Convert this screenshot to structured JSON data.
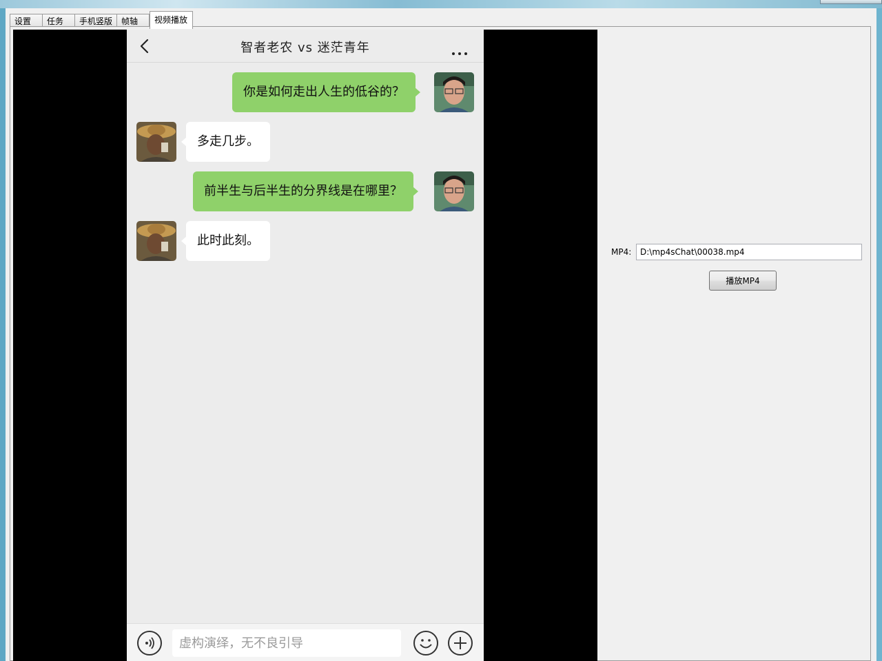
{
  "tabs": [
    {
      "label": "设置"
    },
    {
      "label": "任务"
    },
    {
      "label": "手机竖版"
    },
    {
      "label": "帧轴"
    },
    {
      "label": "视频播放"
    }
  ],
  "chat": {
    "title": "智者老农  vs  迷茫青年",
    "messages": [
      {
        "side": "right",
        "speaker": "youth",
        "text": "你是如何走出人生的低谷的？"
      },
      {
        "side": "left",
        "speaker": "farmer",
        "text": "多走几步。"
      },
      {
        "side": "right",
        "speaker": "youth",
        "text": "前半生与后半生的分界线是在哪里？"
      },
      {
        "side": "left",
        "speaker": "farmer",
        "text": "此时此刻。"
      }
    ],
    "input_placeholder": "虚构演绎，无不良引导",
    "icons": {
      "back": "back-chevron-icon",
      "more": "more-dots-icon",
      "voice": "voice-icon",
      "emoji": "emoji-icon",
      "plus": "plus-icon"
    }
  },
  "controls": {
    "mp4_label": "MP4:",
    "mp4_path": "D:\\mp4sChat\\00038.mp4",
    "play_label": "播放MP4"
  },
  "colors": {
    "outgoing_bubble": "#8fd16a",
    "incoming_bubble": "#ffffff",
    "chat_background": "#ececec",
    "video_background": "#000000"
  }
}
